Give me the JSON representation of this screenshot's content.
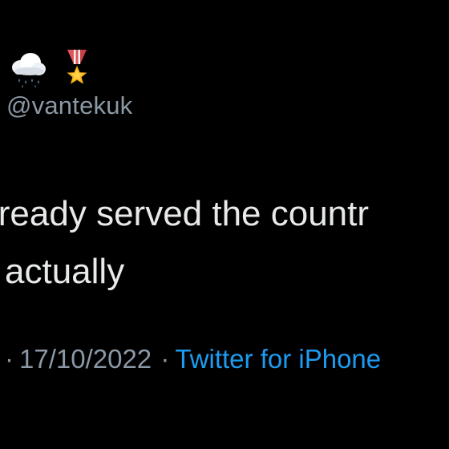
{
  "author": {
    "badges": [
      {
        "icon": "cloud-with-rain-icon"
      },
      {
        "icon": "military-medal-icon"
      }
    ],
    "handle": "@vantekuk"
  },
  "tweet": {
    "lines": [
      "lready served the countr",
      "actually"
    ]
  },
  "meta": {
    "separator": "·",
    "date": "17/10/2022",
    "source": "Twitter for iPhone"
  },
  "colors": {
    "background": "#000000",
    "text_primary": "#e7e9ea",
    "text_secondary": "#8b98a5",
    "link": "#1d9bf0"
  }
}
